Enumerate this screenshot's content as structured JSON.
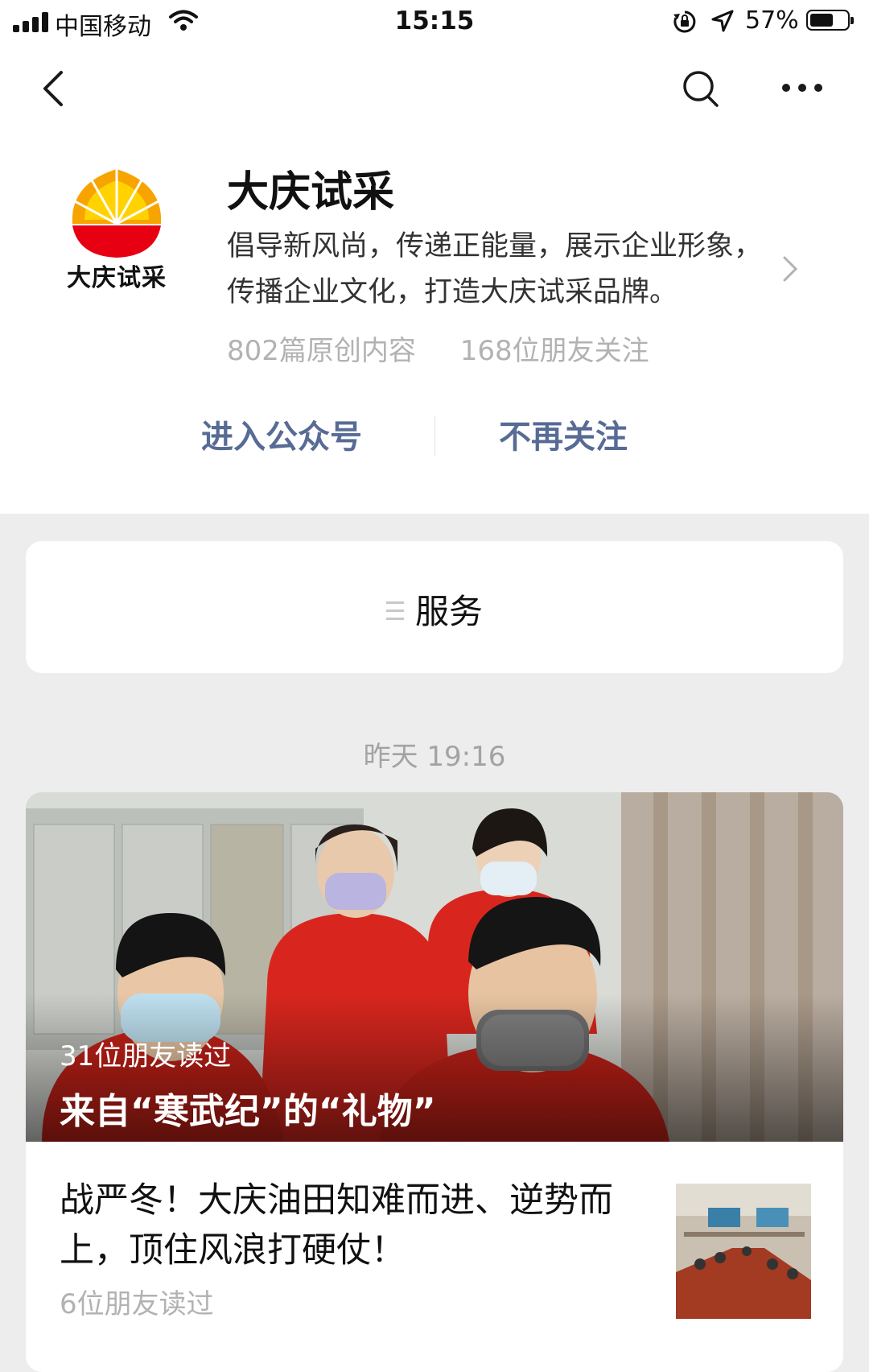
{
  "status_bar": {
    "carrier": "中国移动",
    "time": "15:15",
    "battery_pct": "57%",
    "battery_level": 0.57
  },
  "account": {
    "logo_text": "大庆试采",
    "name": "大庆试采",
    "description": "倡导新风尚，传递正能量，展示企业形象，传播企业文化，打造大庆试采品牌。",
    "original_count": "802篇原创内容",
    "friends_following": "168位朋友关注",
    "enter_label": "进入公众号",
    "unfollow_label": "不再关注"
  },
  "service": {
    "label": "服务"
  },
  "feed": {
    "date": "昨天 19:16",
    "articles": [
      {
        "reads": "31位朋友读过",
        "title": "来自“寒武纪”的“礼物”"
      },
      {
        "title": "战严冬！大庆油田知难而进、逆势而上，顶住风浪打硬仗！",
        "reads": "6位朋友读过"
      }
    ]
  },
  "colors": {
    "link": "#576b95",
    "background": "#ededed",
    "uniform_red": "#d8261e"
  },
  "icons": [
    "signal-icon",
    "wifi-icon",
    "rotation-lock-icon",
    "location-icon",
    "battery-icon",
    "back-icon",
    "search-icon",
    "more-icon",
    "chevron-right-icon",
    "menu-icon"
  ]
}
